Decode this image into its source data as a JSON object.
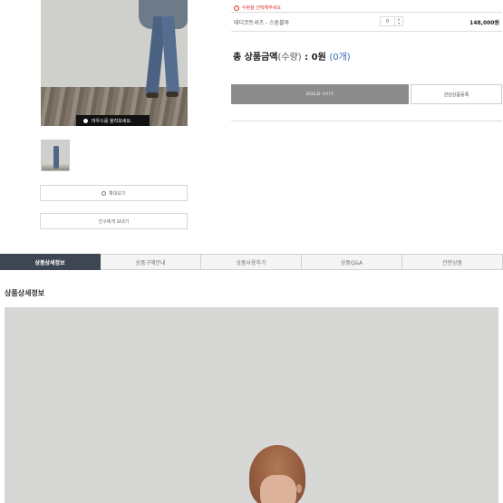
{
  "gallery": {
    "zoom_tip": "마우스를 올려보세요.",
    "zoom_button": "확대보기",
    "share_button": "친구에게 보내기"
  },
  "option": {
    "warning": "수량을 선택해주세요",
    "product_name": "테디코트셔츠 - 스톤블루",
    "quantity": "0",
    "price": "148,000원"
  },
  "total": {
    "label": "총 상품금액",
    "qty_label": "(수량)",
    "separator": " : ",
    "amount": "0원",
    "count": "(0개)"
  },
  "actions": {
    "soldout": "SOLD OUT",
    "wishlist": "관심상품등록"
  },
  "tabs": [
    {
      "label": "상품상세정보",
      "active": true
    },
    {
      "label": "상품구매안내",
      "active": false
    },
    {
      "label": "상품사용후기",
      "active": false
    },
    {
      "label": "상품Q&A",
      "active": false
    },
    {
      "label": "관련상품",
      "active": false
    }
  ],
  "detail": {
    "section_title": "상품상세정보"
  },
  "colors": {
    "active_tab": "#3f4653",
    "soldout_bg": "#8c8c8c",
    "count_blue": "#3b66b7",
    "warning_red": "#dd3333"
  }
}
